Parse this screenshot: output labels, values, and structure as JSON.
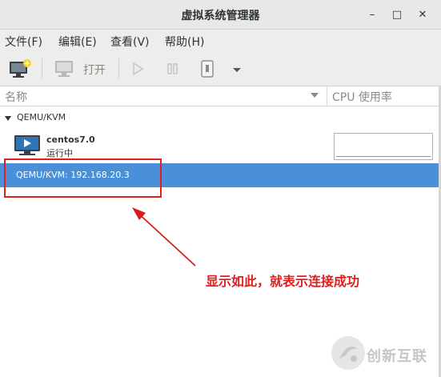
{
  "window": {
    "title": "虚拟系统管理器"
  },
  "window_controls": {
    "minimize": "–",
    "maximize": "□",
    "close": "✕"
  },
  "menubar": {
    "items": [
      "文件(F)",
      "编辑(E)",
      "查看(V)",
      "帮助(H)"
    ]
  },
  "toolbar": {
    "open_label": "打开"
  },
  "table": {
    "col_name": "名称",
    "col_cpu": "CPU 使用率"
  },
  "connections": [
    {
      "label": "QEMU/KVM",
      "vm": {
        "name": "centos7.0",
        "status": "运行中"
      }
    },
    {
      "label": "QEMU/KVM: 192.168.20.3",
      "selected": true
    }
  ],
  "annotation": {
    "text": "显示如此，就表示连接成功"
  },
  "watermark": {
    "text": "创新互联"
  },
  "colors": {
    "selection": "#4a90d9",
    "annotation": "#e31c1c"
  }
}
